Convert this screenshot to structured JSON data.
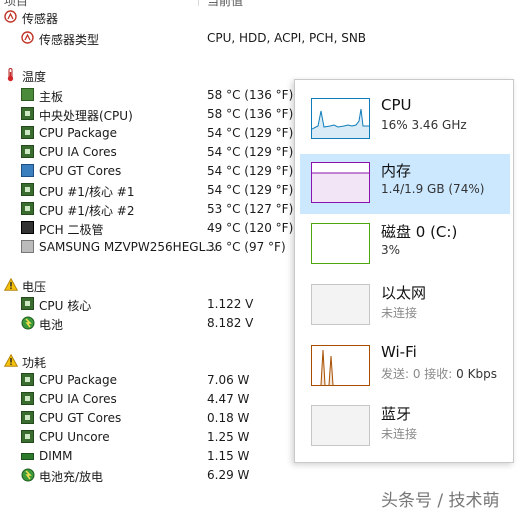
{
  "header": {
    "col1": "项目",
    "col2": "当前值"
  },
  "sensor_section": {
    "label": "传感器",
    "items": [
      {
        "label": "传感器类型",
        "value": "CPU, HDD, ACPI, PCH, SNB"
      }
    ]
  },
  "temperature_section": {
    "label": "温度",
    "items": [
      {
        "label": "主板",
        "value": "58 °C  (136 °F)"
      },
      {
        "label": "中央处理器(CPU)",
        "value": "58 °C  (136 °F)"
      },
      {
        "label": "CPU Package",
        "value": "54 °C  (129 °F)"
      },
      {
        "label": "CPU IA Cores",
        "value": "54 °C  (129 °F)"
      },
      {
        "label": "CPU GT Cores",
        "value": "54 °C  (129 °F)"
      },
      {
        "label": "CPU #1/核心 #1",
        "value": "54 °C  (129 °F)"
      },
      {
        "label": "CPU #1/核心 #2",
        "value": "53 °C  (127 °F)"
      },
      {
        "label": "PCH 二极管",
        "value": "49 °C  (120 °F)"
      },
      {
        "label": "SAMSUNG MZVPW256HEGL...",
        "value": "36 °C  (97 °F)"
      }
    ]
  },
  "voltage_section": {
    "label": "电压",
    "items": [
      {
        "label": "CPU 核心",
        "value": "1.122 V"
      },
      {
        "label": "电池",
        "value": "8.182 V"
      }
    ]
  },
  "power_section": {
    "label": "功耗",
    "items": [
      {
        "label": "CPU Package",
        "value": "7.06 W"
      },
      {
        "label": "CPU IA Cores",
        "value": "4.47 W"
      },
      {
        "label": "CPU GT Cores",
        "value": "0.18 W"
      },
      {
        "label": "CPU Uncore",
        "value": "1.25 W"
      },
      {
        "label": "DIMM",
        "value": "1.15 W"
      },
      {
        "label": "电池充/放电",
        "value": "6.29 W"
      }
    ]
  },
  "task_manager": {
    "items": [
      {
        "title": "CPU",
        "subtitle": "16%  3.46 GHz",
        "color": "#117dbb"
      },
      {
        "title": "内存",
        "subtitle": "1.4/1.9 GB (74%)",
        "color": "#8b12ae"
      },
      {
        "title": "磁盘 0 (C:)",
        "subtitle": "3%",
        "color": "#4da60c"
      },
      {
        "title": "以太网",
        "subtitle": "未连接",
        "color": "#a74f01"
      },
      {
        "title": "Wi-Fi",
        "subtitle_prefix": "发送: 0 接收: ",
        "subtitle_value": "0 Kbps",
        "color": "#a74f01"
      },
      {
        "title": "蓝牙",
        "subtitle": "未连接",
        "color": "#a74f01"
      }
    ],
    "selected": "内存"
  },
  "watermark": "头条号 / 技术萌"
}
